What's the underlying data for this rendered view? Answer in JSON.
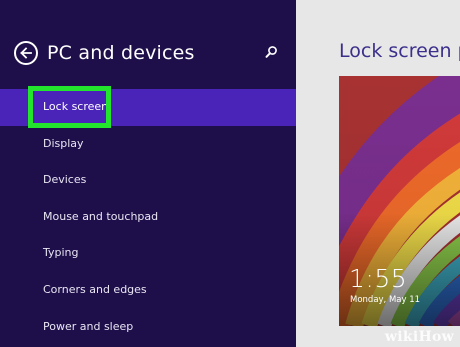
{
  "nav": {
    "title": "PC and devices",
    "items": [
      {
        "label": "Lock screen",
        "selected": true
      },
      {
        "label": "Display"
      },
      {
        "label": "Devices"
      },
      {
        "label": "Mouse and touchpad"
      },
      {
        "label": "Typing"
      },
      {
        "label": "Corners and edges"
      },
      {
        "label": "Power and sleep"
      }
    ]
  },
  "content": {
    "title": "Lock screen pre",
    "preview": {
      "time": "1:55",
      "date": "Monday, May 11"
    }
  },
  "watermark": "wikiHow",
  "colors": {
    "nav_background": "#1e0f4a",
    "selected_background": "#4a23b8",
    "highlight_box": "#23e52e",
    "content_title": "#3b2f8c"
  },
  "icons": {
    "back": "back-arrow-circle-icon",
    "search": "search-icon"
  }
}
